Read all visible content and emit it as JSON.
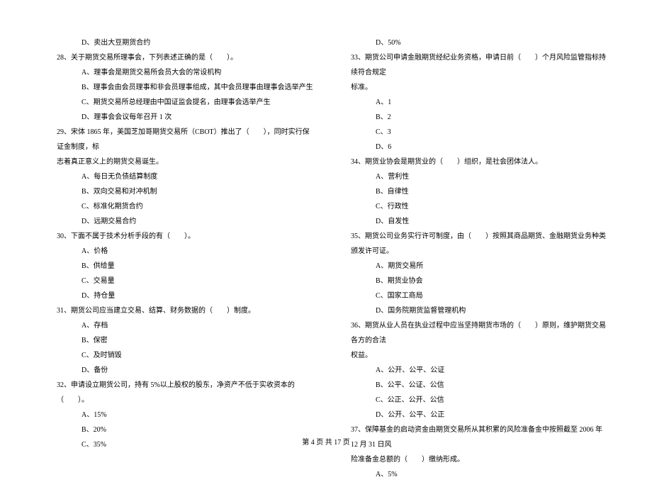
{
  "left_column": {
    "q27_d": "D、卖出大豆期货合约",
    "q28": "28、关于期货交易所理事会，下列表述正确的是（　　）。",
    "q28_a": "A、理事会是期货交易所会员大会的常设机构",
    "q28_b": "B、理事会由会员理事和非会员理事组成，其中会员理事由理事会选举产生",
    "q28_c": "C、期货交易所总经理由中国证监会提名，由理事会选举产生",
    "q28_d": "D、理事会会议每年召开 1 次",
    "q29": "29、宋体 1865 年，美国芝加哥期货交易所（CBOT）推出了（　　），同时实行保证金制度，标",
    "q29_cont": "志着真正意义上的期货交易诞生。",
    "q29_a": "A、每日无负债结算制度",
    "q29_b": "B、双向交易和对冲机制",
    "q29_c": "C、标准化期货合约",
    "q29_d": "D、远期交易合约",
    "q30": "30、下面不属于技术分析手段的有（　　）。",
    "q30_a": "A、价格",
    "q30_b": "B、供给量",
    "q30_c": "C、交易量",
    "q30_d": "D、持仓量",
    "q31": "31、期货公司应当建立交易、结算、财务数据的（　　）制度。",
    "q31_a": "A、存档",
    "q31_b": "B、保密",
    "q31_c": "C、及时销毁",
    "q31_d": "D、备份",
    "q32": "32、申请设立期货公司，持有 5%以上股权的股东，净资产不低于实收资本的（　　）。",
    "q32_a": "A、15%",
    "q32_b": "B、20%",
    "q32_c": "C、35%"
  },
  "right_column": {
    "q32_d": "D、50%",
    "q33": "33、期货公司申请金融期货经纪业务资格，申请日前（　　）个月风险监管指标持续符合规定",
    "q33_cont": "标准。",
    "q33_a": "A、1",
    "q33_b": "B、2",
    "q33_c": "C、3",
    "q33_d": "D、6",
    "q34": "34、期货业协会是期货业的（　　）组织，是社会团体法人。",
    "q34_a": "A、营利性",
    "q34_b": "B、自律性",
    "q34_c": "C、行政性",
    "q34_d": "D、自发性",
    "q35": "35、期货公司业务实行许可制度，由（　　）按照其商品期货、金融期货业务种类颁发许可证。",
    "q35_a": "A、期货交易所",
    "q35_b": "B、期货业协会",
    "q35_c": "C、国家工商局",
    "q35_d": "D、国务院期货监督管理机构",
    "q36": "36、期货从业人员在执业过程中应当坚持期货市场的（　　）原则，维护期货交易各方的合法",
    "q36_cont": "权益。",
    "q36_a": "A、公开、公平、公证",
    "q36_b": "B、公平、公证、公信",
    "q36_c": "C、公正、公开、公信",
    "q36_d": "D、公开、公平、公正",
    "q37": "37、保障基金的启动资金由期货交易所从其积累的风险准备金中按照截至 2006 年 12 月 31 日风",
    "q37_cont": "险准备金总额的（　　）缴纳形成。",
    "q37_a": "A、5%"
  },
  "footer": "第 4 页 共 17 页"
}
